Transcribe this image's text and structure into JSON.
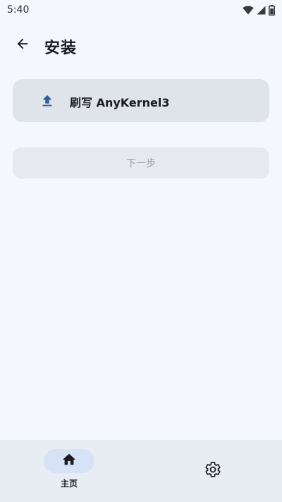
{
  "status_bar": {
    "time": "5:40",
    "icons": [
      "wifi-icon",
      "cellular-signal-icon",
      "battery-icon"
    ]
  },
  "app_bar": {
    "back_icon": "arrow-back-icon",
    "title": "安装"
  },
  "flash_card": {
    "icon": "upload-icon",
    "label": "刷写 AnyKernel3"
  },
  "next_button": {
    "label": "下一步",
    "enabled": false
  },
  "bottom_nav": {
    "items": [
      {
        "icon": "home-icon",
        "label": "主页",
        "selected": true
      },
      {
        "icon": "gear-icon",
        "label": "",
        "selected": false
      }
    ]
  },
  "colors": {
    "background": "#f4f8fd",
    "card": "#dfe3ea",
    "accent_icon": "#2f5f9e",
    "nav_background": "#e8ecf3",
    "nav_selected_pill": "#d6e3f7",
    "disabled_text": "#9ba0a6"
  }
}
